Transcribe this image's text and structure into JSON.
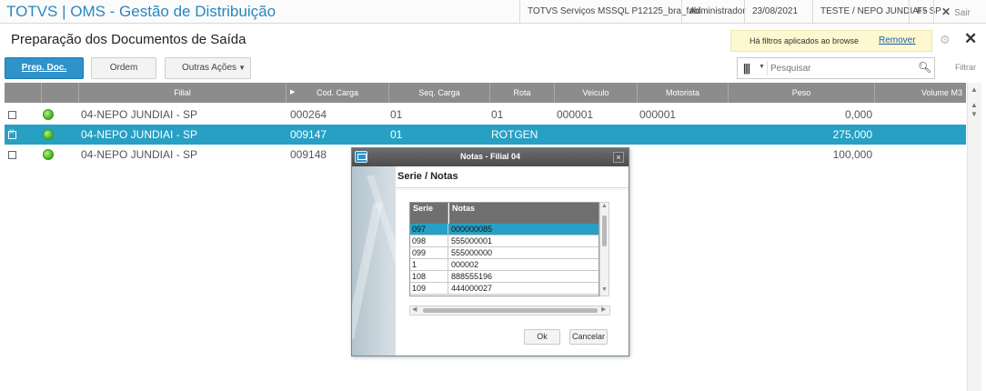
{
  "titlebar": {
    "app_title": "TOTVS | OMS - Gestão de Distribuição",
    "environment": "TOTVS Serviços MSSQL P12125_bra_fabi",
    "user": "Administrador",
    "date": "23/08/2021",
    "branch": "TESTE / NEPO JUNDIAI - SP",
    "shortcut": "F5",
    "exit_label": "Sair"
  },
  "header": {
    "page_title": "Preparação dos Documentos de Saída",
    "filter_message": "Há filtros aplicados ao browse",
    "filter_remove": "Remover"
  },
  "toolbar": {
    "primary_label": "Prep. Doc.",
    "ordem_label": "Ordem",
    "outras_label": "Outras Ações",
    "search_placeholder": "Pesquisar",
    "filter_label": "Filtrar"
  },
  "grid": {
    "columns": [
      "Filial",
      "Cod. Carga",
      "Seq. Carga",
      "Rota",
      "Veiculo",
      "Motorista",
      "Peso",
      "Volume M3"
    ],
    "rows": [
      {
        "filial": "04-NEPO JUNDIAI - SP",
        "cod_carga": "000264",
        "seq_carga": "01",
        "rota": "01",
        "veiculo": "000001",
        "motorista": "000001",
        "peso": "0,000",
        "selected": false
      },
      {
        "filial": "04-NEPO JUNDIAI - SP",
        "cod_carga": "009147",
        "seq_carga": "01",
        "rota": "ROTGEN",
        "veiculo": "",
        "motorista": "",
        "peso": "275,000",
        "selected": true
      },
      {
        "filial": "04-NEPO JUNDIAI - SP",
        "cod_carga": "009148",
        "seq_carga": "",
        "rota": "",
        "veiculo": "",
        "motorista": "",
        "peso": "100,000",
        "selected": false
      }
    ]
  },
  "modal": {
    "title": "Notas - Filial 04",
    "heading": "Serie / Notas",
    "columns": [
      "Serie",
      "Notas"
    ],
    "rows": [
      {
        "serie": "097",
        "nota": "000000085"
      },
      {
        "serie": "098",
        "nota": "555000001"
      },
      {
        "serie": "099",
        "nota": "555000000"
      },
      {
        "serie": "1",
        "nota": "000002"
      },
      {
        "serie": "108",
        "nota": "888555196"
      },
      {
        "serie": "109",
        "nota": "444000027"
      }
    ],
    "ok_label": "Ok",
    "cancel_label": "Cancelar"
  },
  "colors": {
    "brand": "#2a86bf",
    "selection": "#27a0c4",
    "grid_header": "#8c8c8c",
    "status_ok": "#45b51c"
  }
}
